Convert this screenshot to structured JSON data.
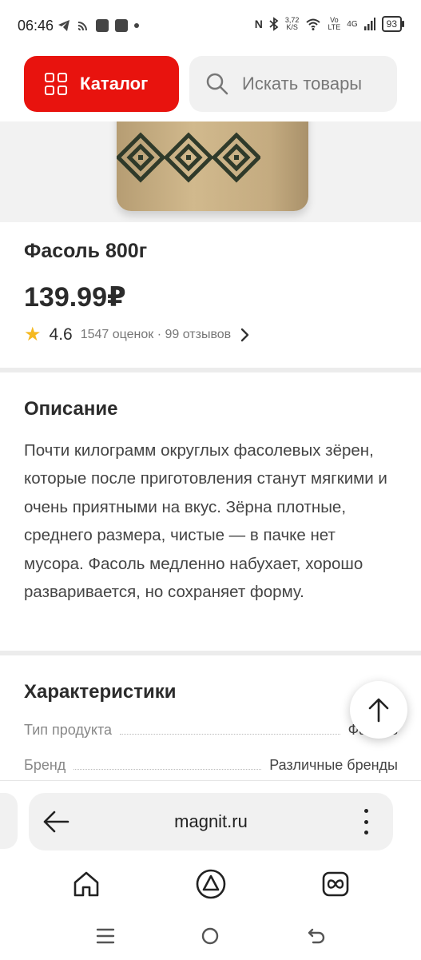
{
  "status_bar": {
    "time": "06:46",
    "net_speed": "3,72\nK/S",
    "volte": "Vo\nLTE",
    "signal": "4G",
    "battery": "93"
  },
  "header": {
    "catalog_label": "Каталог",
    "search_placeholder": "Искать товары"
  },
  "product": {
    "title": "Фасоль 800г",
    "price": "139.99₽",
    "rating": "4.6",
    "rating_meta": "1547 оценок · 99 отзывов"
  },
  "description": {
    "title": "Описание",
    "text": "Почти килограмм округлых фасолевых зёрен, которые после приготовления станут мягкими и очень приятными на вкус. Зёрна плотные, среднего размера, чистые — в пачке нет мусора. Фасоль медленно набухает, хорошо разваривается, но сохраняет форму."
  },
  "specs": {
    "title": "Характеристики",
    "rows": [
      {
        "name": "Тип продукта",
        "value": "Фасоль"
      },
      {
        "name": "Бренд",
        "value": "Различные бренды"
      }
    ]
  },
  "browser": {
    "url": "magnit.ru"
  },
  "icons": {
    "catalog": "grid-icon",
    "search": "search-icon",
    "rating": "star-icon",
    "scroll_up": "arrow-up-icon",
    "back": "arrow-left-icon",
    "menu": "more-vertical-icon",
    "home": "home-icon",
    "alice": "alice-icon",
    "tabs": "tabs-icon"
  },
  "colors": {
    "brand_red": "#e8130e",
    "star": "#f5b921"
  }
}
